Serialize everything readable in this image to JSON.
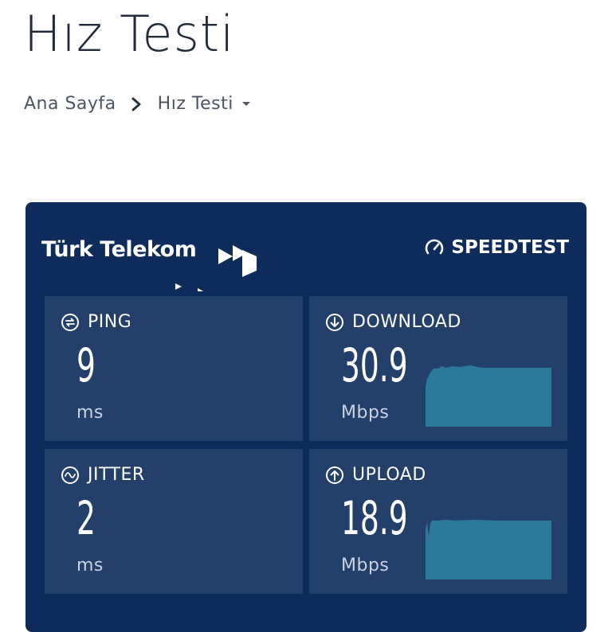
{
  "page": {
    "title": "Hız Testi"
  },
  "breadcrumb": {
    "home": "Ana Sayfa",
    "current": "Hız Testi"
  },
  "widget": {
    "brand": "Türk Telekom",
    "provider": "SPEEDTEST",
    "colors": {
      "background": "#0d2c5b",
      "card": "#22406a",
      "graph": "#2b7a9a"
    },
    "metrics": {
      "ping": {
        "label": "PING",
        "value": "9",
        "unit": "ms",
        "icon": "ping-icon"
      },
      "download": {
        "label": "DOWNLOAD",
        "value": "30.9",
        "unit": "Mbps",
        "icon": "download-arrow-icon"
      },
      "jitter": {
        "label": "JITTER",
        "value": "2",
        "unit": "ms",
        "icon": "jitter-wave-icon"
      },
      "upload": {
        "label": "UPLOAD",
        "value": "18.9",
        "unit": "Mbps",
        "icon": "upload-arrow-icon"
      }
    }
  }
}
